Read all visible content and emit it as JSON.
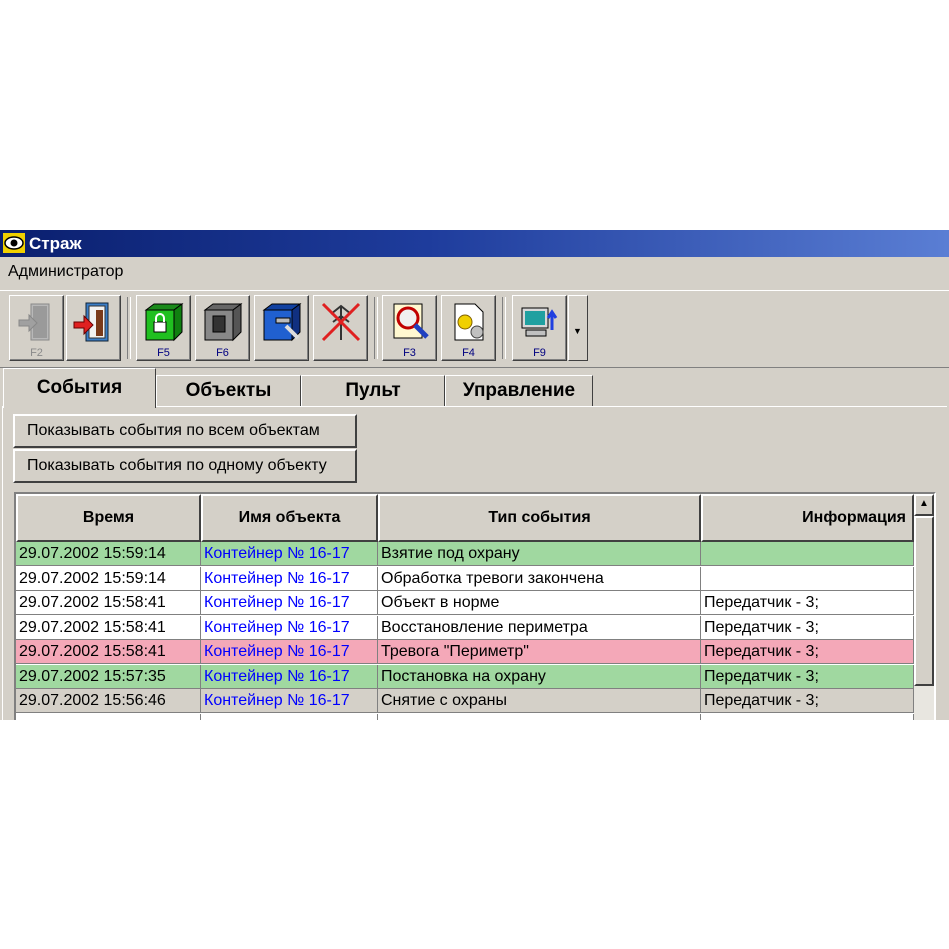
{
  "window": {
    "title": "Страж"
  },
  "menu": {
    "user": "Администратор"
  },
  "toolbar": {
    "buttons": [
      {
        "fkey": "F2",
        "icon": "arm-exit-icon",
        "enabled": false
      },
      {
        "fkey": "",
        "icon": "exit-door-icon",
        "enabled": true
      },
      {
        "fkey": "F5",
        "icon": "green-lock-box-icon",
        "enabled": true
      },
      {
        "fkey": "F6",
        "icon": "gray-box-icon",
        "enabled": true
      },
      {
        "fkey": "",
        "icon": "blue-box-tools-icon",
        "enabled": true
      },
      {
        "fkey": "",
        "icon": "antenna-crossed-icon",
        "enabled": true
      },
      {
        "fkey": "F3",
        "icon": "search-ns-icon",
        "enabled": true
      },
      {
        "fkey": "F4",
        "icon": "settings-document-icon",
        "enabled": true
      },
      {
        "fkey": "F9",
        "icon": "computer-network-icon",
        "enabled": true
      }
    ]
  },
  "tabs": [
    "События",
    "Объекты",
    "Пульт",
    "Управление"
  ],
  "filters": {
    "all_label": "Показывать события по всем объектам",
    "one_label": "Показывать события по одному объекту"
  },
  "table": {
    "columns": [
      "Время",
      "Имя объекта",
      "Тип события",
      "Информация"
    ],
    "rows": [
      {
        "time": "29.07.2002 15:59:14",
        "object": "Контейнер № 16-17",
        "type": "Взятие под охрану",
        "info": "",
        "color": "#a0d8a0"
      },
      {
        "time": "29.07.2002 15:59:14",
        "object": "Контейнер № 16-17",
        "type": "Обработка тревоги закончена",
        "info": "",
        "color": "#ffffff"
      },
      {
        "time": "29.07.2002 15:58:41",
        "object": "Контейнер № 16-17",
        "type": "Объект в норме",
        "info": "Передатчик - 3;",
        "color": "#ffffff"
      },
      {
        "time": "29.07.2002 15:58:41",
        "object": "Контейнер № 16-17",
        "type": "Восстановление периметра",
        "info": "Передатчик - 3;",
        "color": "#ffffff"
      },
      {
        "time": "29.07.2002 15:58:41",
        "object": "Контейнер № 16-17",
        "type": "Тревога \"Периметр\"",
        "info": "Передатчик - 3;",
        "color": "#f4a8b8"
      },
      {
        "time": "29.07.2002 15:57:35",
        "object": "Контейнер № 16-17",
        "type": "Постановка на охрану",
        "info": "Передатчик - 3;",
        "color": "#a0d8a0"
      },
      {
        "time": "29.07.2002 15:56:46",
        "object": "Контейнер № 16-17",
        "type": "Снятие с охраны",
        "info": "Передатчик - 3;",
        "color": "#d4d0c8"
      }
    ]
  }
}
